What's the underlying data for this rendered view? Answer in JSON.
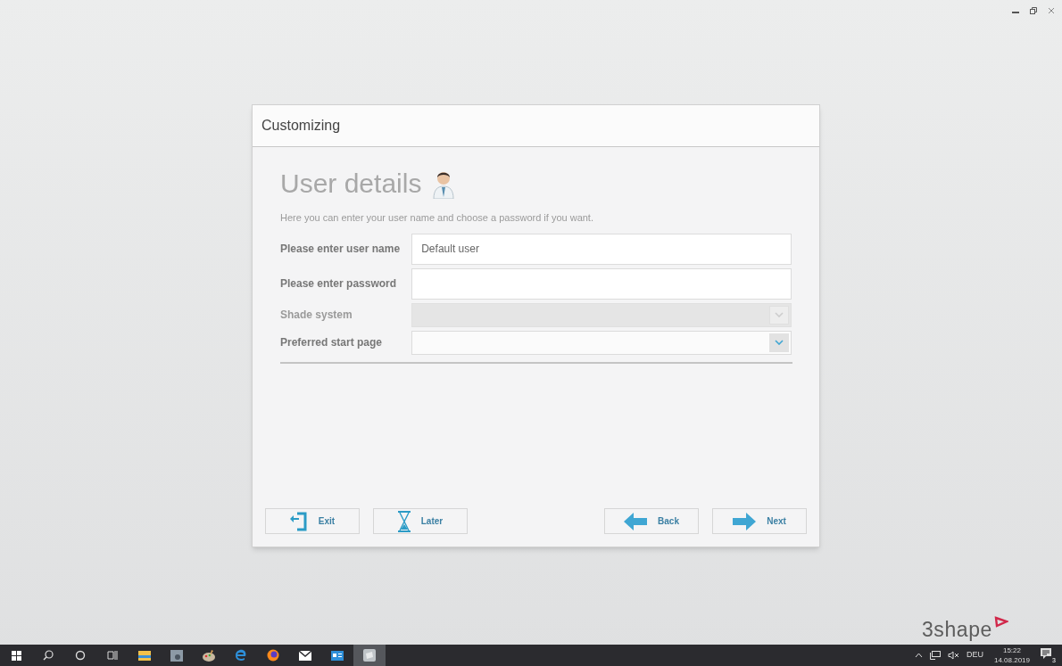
{
  "dialog": {
    "title": "Customizing",
    "heading": "User details",
    "description": "Here you can enter your user name and choose a password if you want.",
    "fields": [
      {
        "kind": "text",
        "label": "Please enter user name",
        "value": "Default user"
      },
      {
        "kind": "password",
        "label": "Please enter password"
      },
      {
        "kind": "dropdown",
        "label": "Shade system",
        "disabled": true
      },
      {
        "kind": "dropdown",
        "label": "Preferred start page",
        "disabled": false
      }
    ],
    "buttons": [
      {
        "kind": "exit",
        "label": "Exit"
      },
      {
        "kind": "later",
        "label": "Later"
      },
      {
        "kind": "back",
        "label": "Back"
      },
      {
        "kind": "next",
        "label": "Next"
      }
    ]
  },
  "logo": "3shape",
  "taskbar": {
    "apps": [
      {
        "kind": "folder",
        "selected": false
      },
      {
        "kind": "viewer",
        "selected": false
      },
      {
        "kind": "paint",
        "selected": false
      },
      {
        "kind": "browser-e",
        "selected": false
      },
      {
        "kind": "browser-fox",
        "selected": false
      },
      {
        "kind": "mail",
        "selected": false
      },
      {
        "kind": "card",
        "selected": false
      },
      {
        "kind": "app",
        "selected": true
      }
    ],
    "language": "DEU",
    "time": "15:22",
    "date": "14.08.2019",
    "notifications": "3"
  }
}
